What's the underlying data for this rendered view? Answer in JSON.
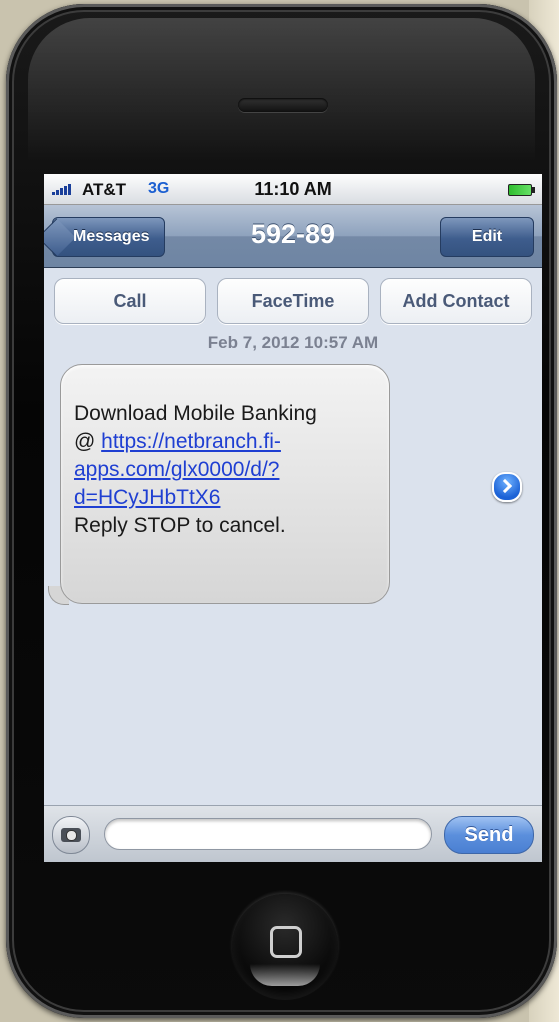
{
  "status_bar": {
    "carrier": "AT&T",
    "network": "3G",
    "time": "11:10 AM"
  },
  "nav": {
    "back_label": "Messages",
    "title": "592-89",
    "edit_label": "Edit"
  },
  "actions": {
    "call": "Call",
    "facetime": "FaceTime",
    "add_contact": "Add Contact"
  },
  "thread": {
    "timestamp": "Feb 7, 2012 10:57 AM",
    "message": {
      "line1": "Download Mobile Banking",
      "at": "@ ",
      "link_line1": "https://netbranch.fi-",
      "link_line2": "apps.com/glx0000/d/?",
      "link_line3": "d=HCyJHbTtX6",
      "line_last": "Reply STOP to cancel."
    }
  },
  "composer": {
    "input_value": "",
    "send_label": "Send"
  },
  "icons": [
    "signal-icon",
    "battery-icon",
    "detail-disclosure-icon",
    "camera-icon",
    "home-button-icon"
  ]
}
